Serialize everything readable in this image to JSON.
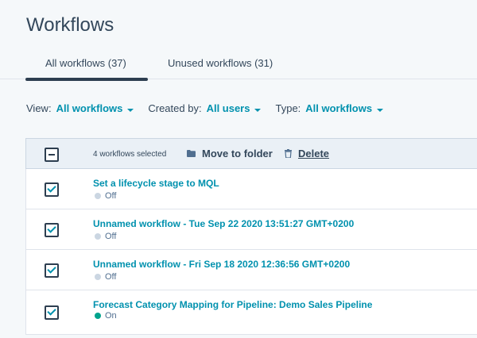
{
  "page": {
    "title": "Workflows"
  },
  "tabs": [
    {
      "label": "All workflows (37)",
      "active": true
    },
    {
      "label": "Unused workflows (31)",
      "active": false
    }
  ],
  "filters": [
    {
      "label": "View:",
      "value": "All workflows"
    },
    {
      "label": "Created by:",
      "value": "All users"
    },
    {
      "label": "Type:",
      "value": "All workflows"
    }
  ],
  "bulk": {
    "selected_text": "4 workflows selected",
    "move_label": "Move to folder",
    "delete_label": "Delete"
  },
  "colors": {
    "accent": "#0091ae",
    "on": "#00a38d",
    "off": "#cbd6e2",
    "dark": "#2d3e50"
  },
  "workflows": [
    {
      "name": "Set a lifecycle stage to MQL",
      "status": "Off",
      "checked": true
    },
    {
      "name": "Unnamed workflow - Tue Sep 22 2020 13:51:27 GMT+0200",
      "status": "Off",
      "checked": true
    },
    {
      "name": "Unnamed workflow - Fri Sep 18 2020 12:36:56 GMT+0200",
      "status": "Off",
      "checked": true
    },
    {
      "name": "Forecast Category Mapping for Pipeline: Demo Sales Pipeline",
      "status": "On",
      "checked": true
    }
  ]
}
